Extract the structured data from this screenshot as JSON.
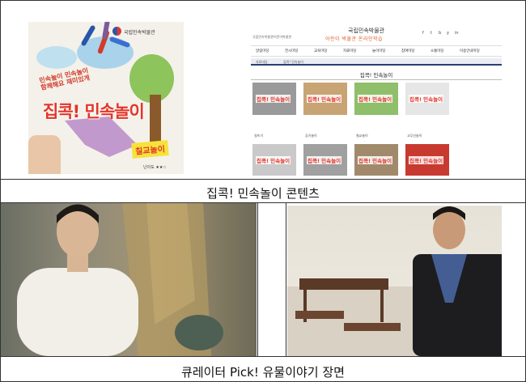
{
  "top_caption": "집콕! 민속놀이 콘텐츠",
  "bottom_caption": "큐레이터 Pick! 유물이야기 장면",
  "poster": {
    "brand": "국립민속박물관",
    "subtitle": "민속놀이 민속놀이 함께해요 재미있게",
    "title": "집콕! 민속놀이",
    "sticker": "칠교놀이",
    "footer": "난이도 ★★☆"
  },
  "website": {
    "org": "국립민속박물관",
    "site_title": "어린이 박물관 온라인학습",
    "util_links": [
      "국립민속박물관",
      "어린이박물관"
    ],
    "social_icons": [
      "f",
      "t",
      "b",
      "y",
      "in"
    ],
    "nav_items": [
      "알림마당",
      "전시마당",
      "교육마당",
      "자료마당",
      "놀이마당",
      "참여마당",
      "소통마당",
      "이용안내마당"
    ],
    "breadcrumb": [
      "자료마당",
      "집콕! 민속놀이"
    ],
    "page_title": "집콕! 민속놀이",
    "thumbnails": [
      {
        "title": "집콕! 민속놀이",
        "caption": "실뜨기",
        "bg": "#9a9a9a"
      },
      {
        "title": "집콕! 민속놀이",
        "caption": "공기놀이",
        "bg": "#c8a474"
      },
      {
        "title": "집콕! 민속놀이",
        "caption": "칠교놀이",
        "bg": "#8fbf6a"
      },
      {
        "title": "집콕! 민속놀이",
        "caption": "고무신놀이",
        "bg": "#e6e6e6"
      },
      {
        "title": "집콕! 민속놀이",
        "caption": "",
        "bg": "#c9c9c9"
      },
      {
        "title": "집콕! 민속놀이",
        "caption": "",
        "bg": "#a0a0a0"
      },
      {
        "title": "집콕! 민속놀이",
        "caption": "",
        "bg": "#a18a6c"
      },
      {
        "title": "집콕! 민속놀이",
        "caption": "",
        "bg": "#c83a30"
      }
    ]
  },
  "colors": {
    "accent_red": "#e2352a",
    "nav_blue": "#2b3f73",
    "border": "#333333"
  }
}
